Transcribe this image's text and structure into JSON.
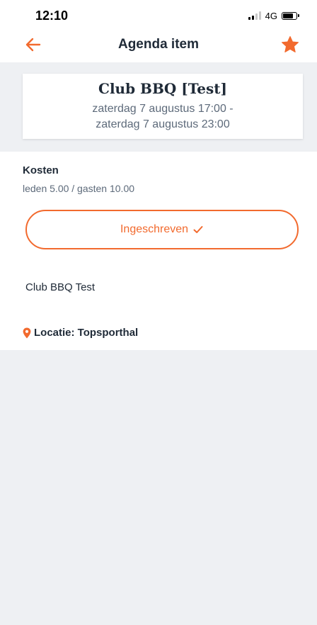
{
  "status_bar": {
    "time": "12:10",
    "network": "4G"
  },
  "nav": {
    "title": "Agenda item"
  },
  "event": {
    "title": "Club BBQ [Test]",
    "date_start": "zaterdag 7 augustus 17:00 -",
    "date_end": "zaterdag 7 augustus 23:00"
  },
  "costs": {
    "label": "Kosten",
    "value": "leden 5.00 / gasten 10.00"
  },
  "signup": {
    "label": "Ingeschreven"
  },
  "description": "Club BBQ Test",
  "location": {
    "label": "Locatie: Topsporthal"
  },
  "colors": {
    "accent": "#f26a2e",
    "text_primary": "#1f2a37",
    "text_secondary": "#5d6a7a",
    "band_background": "#eef0f3"
  },
  "icons": {
    "back": "arrow-left-icon",
    "favorite": "star-icon",
    "registered": "check-icon",
    "location": "map-pin-icon"
  }
}
